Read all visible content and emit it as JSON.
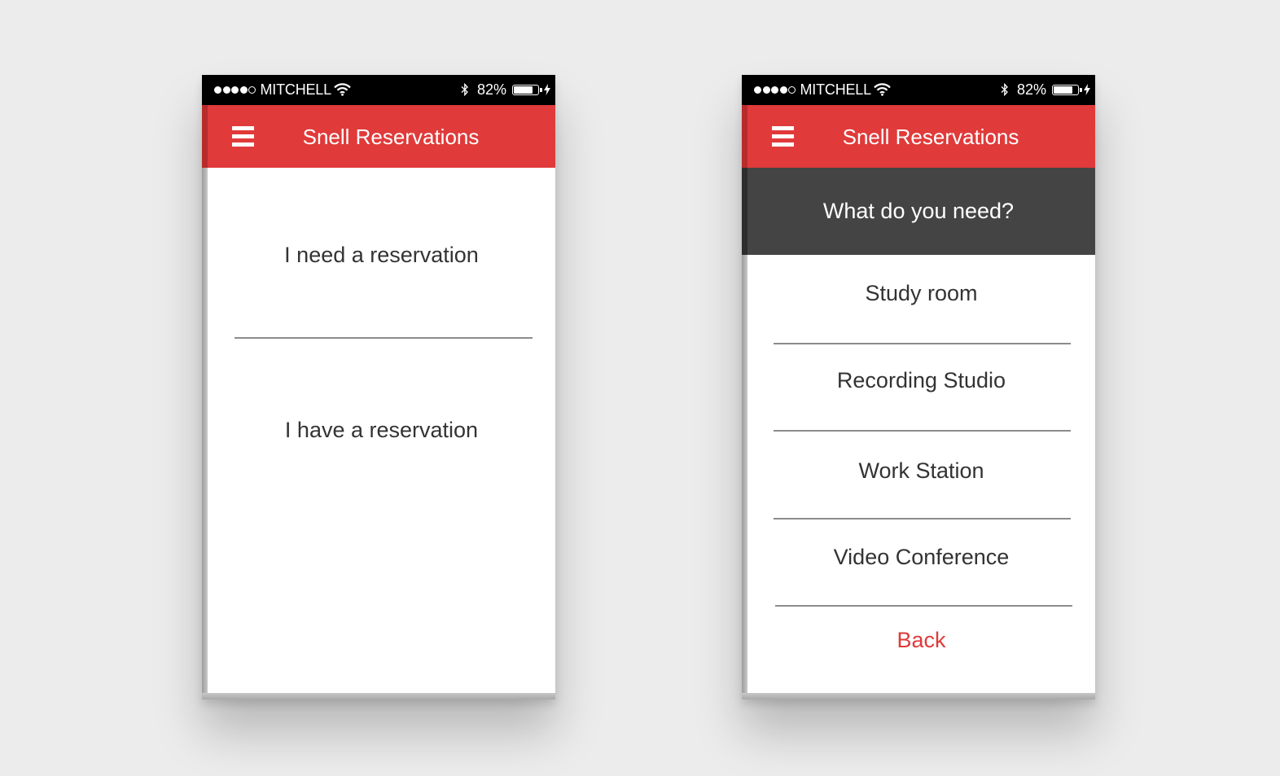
{
  "status_bar": {
    "carrier": "MITCHELL",
    "battery": "82%",
    "battery_level": 0.82
  },
  "app": {
    "title": "Snell Reservations"
  },
  "screen_home": {
    "options": [
      {
        "label": "I need a reservation"
      },
      {
        "label": "I have a reservation"
      }
    ]
  },
  "screen_need": {
    "question": "What do you need?",
    "options": [
      {
        "label": "Study room"
      },
      {
        "label": "Recording Studio"
      },
      {
        "label": "Work Station"
      },
      {
        "label": "Video Conference"
      }
    ],
    "back_label": "Back"
  },
  "colors": {
    "accent": "#e03a3a",
    "question_bg": "#444444",
    "background": "#ececec",
    "status_bar": "#000000"
  },
  "icons": [
    "menu-icon",
    "wifi-icon",
    "bluetooth-icon",
    "battery-icon",
    "charging-bolt-icon"
  ]
}
